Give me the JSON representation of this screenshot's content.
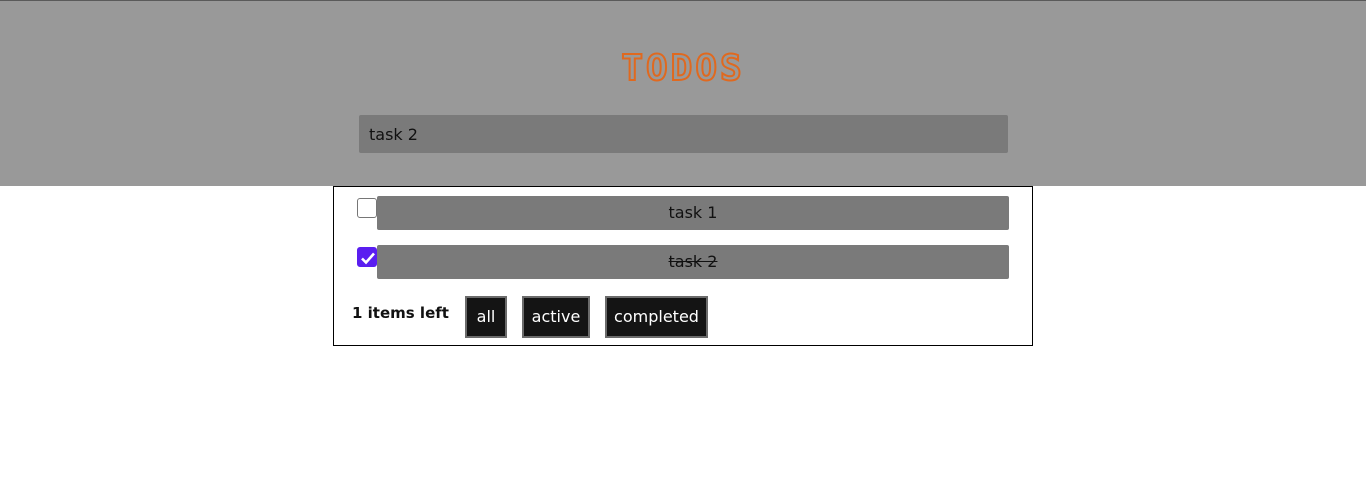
{
  "header": {
    "logo_text": "TODOS",
    "new_todo_value": "task 2"
  },
  "todos": [
    {
      "label": "task 1",
      "completed": false
    },
    {
      "label": "task 2",
      "completed": true
    }
  ],
  "footer": {
    "items_left": "1 items left",
    "filters": {
      "all": "all",
      "active": "active",
      "completed": "completed"
    }
  },
  "colors": {
    "header_bg": "#999999",
    "logo": "#e0691f",
    "input_bg": "#7a7a7a",
    "checkbox_accent": "#5a1ef0",
    "button_bg": "#141414"
  }
}
